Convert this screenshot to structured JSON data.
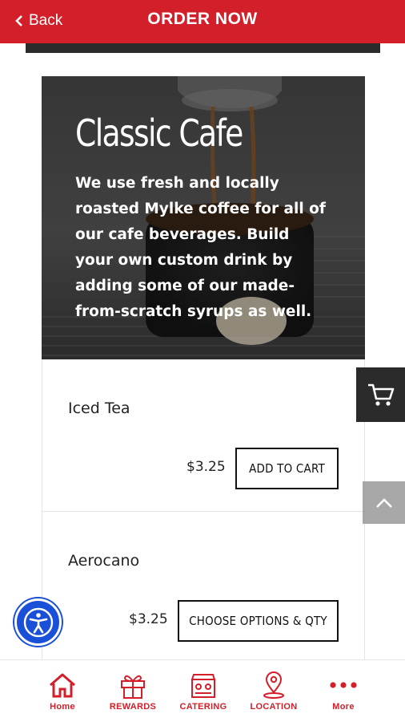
{
  "header": {
    "back_label": "Back",
    "title": "ORDER NOW",
    "accent_color": "#d21f2a"
  },
  "hero": {
    "title": "Classic Cafe",
    "description": "We use fresh and locally roasted Mylke coffee for all of our cafe beverages. Build your own custom drink by adding some of our made-from-scratch syrups as well."
  },
  "items": [
    {
      "name": "Iced Tea",
      "price": "$3.25",
      "button_label": "ADD TO CART"
    },
    {
      "name": "Aerocano",
      "price": "$3.25",
      "button_label": "CHOOSE OPTIONS & QTY"
    }
  ],
  "floating": {
    "cart_icon": "cart-icon",
    "scroll_top_icon": "chevron-up-icon",
    "accessibility_icon": "accessibility-icon"
  },
  "bottom_nav": [
    {
      "label": "Home",
      "icon": "home-icon"
    },
    {
      "label": "REWARDS",
      "icon": "gift-icon"
    },
    {
      "label": "CATERING",
      "icon": "catering-icon"
    },
    {
      "label": "LOCATION",
      "icon": "location-pin-icon"
    },
    {
      "label": "More",
      "icon": "more-dots-icon"
    }
  ]
}
